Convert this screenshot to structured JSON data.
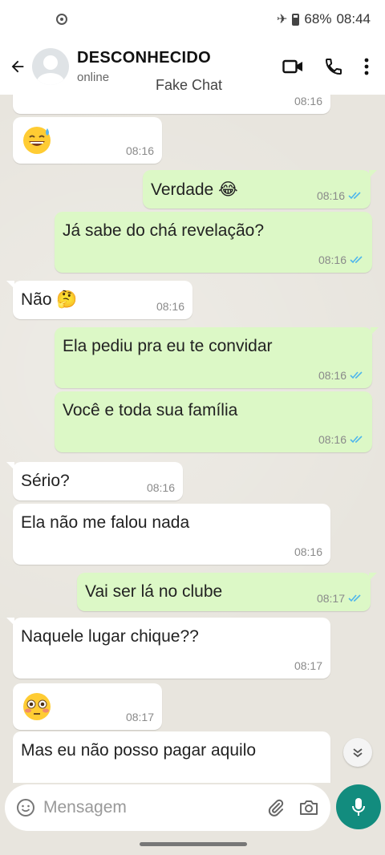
{
  "status_bar": {
    "battery": "68%",
    "time": "08:44"
  },
  "header": {
    "contact_name": "DESCONHECIDO",
    "contact_status": "online",
    "app_label": "Fake Chat"
  },
  "messages": [
    {
      "dir": "in",
      "text": "",
      "time": "08:16"
    },
    {
      "dir": "in",
      "emoji": "sweat-smile",
      "time": "08:16"
    },
    {
      "dir": "out",
      "text": "Verdade 😂",
      "time": "08:16"
    },
    {
      "dir": "out",
      "text": "Já sabe do chá revelação?",
      "time": "08:16"
    },
    {
      "dir": "in",
      "text": "Não 🤔",
      "time": "08:16"
    },
    {
      "dir": "out",
      "text": "Ela pediu pra eu te convidar",
      "time": "08:16"
    },
    {
      "dir": "out",
      "text": "Você e toda sua família",
      "time": "08:16"
    },
    {
      "dir": "in",
      "text": "Sério?",
      "time": "08:16"
    },
    {
      "dir": "in",
      "text": "Ela não me falou nada",
      "time": "08:16"
    },
    {
      "dir": "out",
      "text": "Vai ser lá no clube",
      "time": "08:17"
    },
    {
      "dir": "in",
      "text": "Naquele lugar chique??",
      "time": "08:17"
    },
    {
      "dir": "in",
      "emoji": "flushed",
      "time": "08:17"
    },
    {
      "dir": "in",
      "text": "Mas eu não posso pagar aquilo",
      "time": ""
    }
  ],
  "input": {
    "placeholder": "Mensagem"
  },
  "colors": {
    "incoming": "#ffffff",
    "outgoing": "#dcf8c6",
    "accent": "#128c7e",
    "read_ticks": "#4fb6ec"
  }
}
